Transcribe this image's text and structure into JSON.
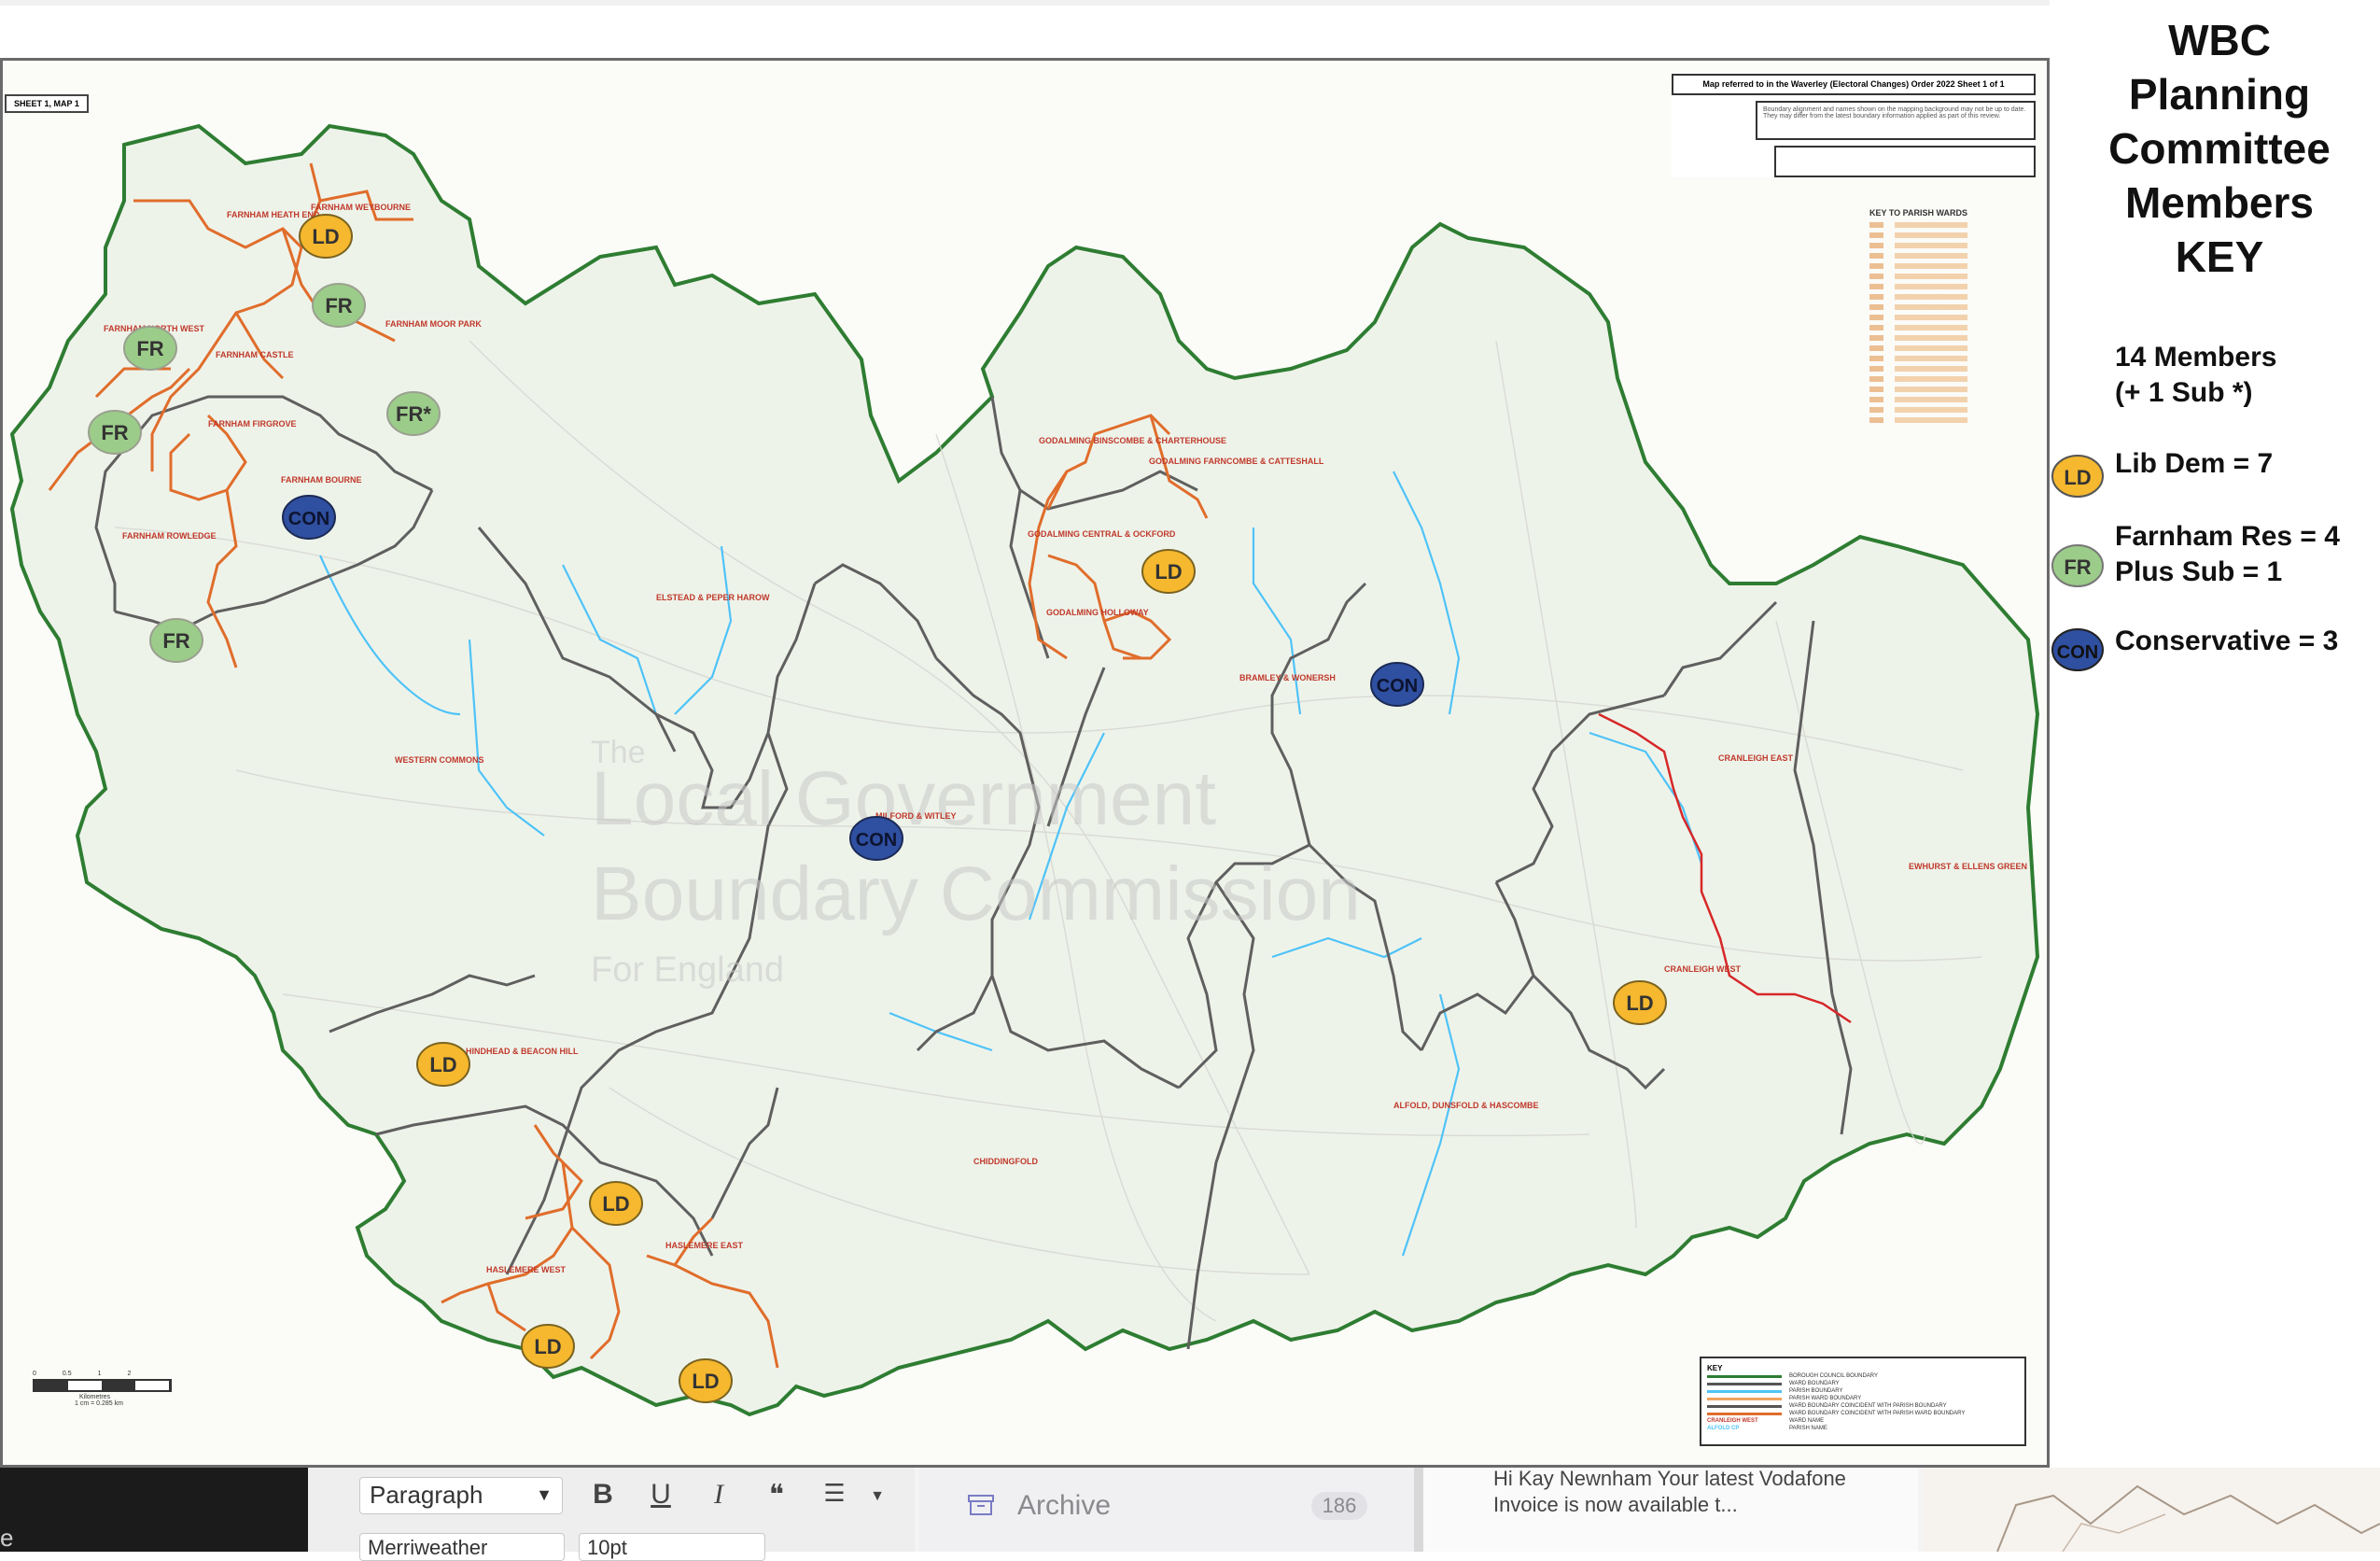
{
  "map": {
    "sheet_label": "SHEET 1, MAP 1",
    "order_title": "Map referred to in the Waverley (Electoral Changes) Order 2022 Sheet 1 of 1",
    "order_note": "Boundary alignment and names shown on the mapping background may not be up to date. They may differ from the latest boundary information applied as part of this review.",
    "parish_key_title": "KEY TO PARISH WARDS",
    "watermark": [
      "The",
      "Local Government",
      "Boundary Commission",
      "For England"
    ],
    "wards": [
      "FARNHAM HEATH END",
      "FARNHAM WEYBOURNE",
      "FARNHAM NORTH WEST",
      "FARNHAM CASTLE",
      "FARNHAM MOOR PARK",
      "FARNHAM FIRGROVE",
      "FARNHAM BOURNE",
      "FARNHAM ROWLEDGE",
      "GODALMING BINSCOMBE & CHARTERHOUSE",
      "GODALMING FARNCOMBE & CATTESHALL",
      "GODALMING CENTRAL & OCKFORD",
      "GODALMING HOLLOWAY",
      "ELSTEAD & PEPER HAROW",
      "BRAMLEY & WONERSH",
      "WESTERN COMMONS",
      "MILFORD & WITLEY",
      "CRANLEIGH EAST",
      "CRANLEIGH WEST",
      "EWHURST & ELLENS GREEN",
      "HINDHEAD & BEACON HILL",
      "HASLEMERE WEST",
      "HASLEMERE EAST",
      "CHIDDINGFOLD",
      "ALFOLD, DUNSFOLD & HASCOMBE"
    ],
    "map_key": {
      "title": "KEY",
      "rows": [
        {
          "label": "BOROUGH COUNCIL BOUNDARY",
          "color": "#2e7d32"
        },
        {
          "label": "WARD BOUNDARY",
          "color": "#555555"
        },
        {
          "label": "PARISH BOUNDARY",
          "color": "#4fc3f7"
        },
        {
          "label": "PARISH WARD BOUNDARY",
          "color": "#f0a35e"
        },
        {
          "label": "WARD BOUNDARY COINCIDENT WITH PARISH BOUNDARY",
          "color": "#555555"
        },
        {
          "label": "WARD BOUNDARY COINCIDENT WITH PARISH WARD BOUNDARY",
          "color": "#e06d2b"
        },
        {
          "label": "WARD NAME",
          "color": "#c0392b",
          "sample": "CRANLEIGH WEST"
        },
        {
          "label": "PARISH NAME",
          "color": "#4fc3f7",
          "sample": "ALFOLD CP"
        }
      ]
    },
    "scale": {
      "ticks": [
        "0",
        "0.5",
        "1",
        "2"
      ],
      "unit": "Kilometres",
      "ratio": "1 cm = 0.285 km"
    },
    "markers": [
      {
        "type": "LD",
        "label": "LD"
      },
      {
        "type": "FR",
        "label": "FR"
      },
      {
        "type": "FR",
        "label": "FR"
      },
      {
        "type": "FR",
        "label": "FR"
      },
      {
        "type": "FR",
        "label": "FR*"
      },
      {
        "type": "CON",
        "label": "CON"
      },
      {
        "type": "FR",
        "label": "FR"
      },
      {
        "type": "LD",
        "label": "LD"
      },
      {
        "type": "CON",
        "label": "CON"
      },
      {
        "type": "CON",
        "label": "CON"
      },
      {
        "type": "LD",
        "label": "LD"
      },
      {
        "type": "LD",
        "label": "LD"
      },
      {
        "type": "LD",
        "label": "LD"
      },
      {
        "type": "LD",
        "label": "LD"
      },
      {
        "type": "LD",
        "label": "LD"
      }
    ]
  },
  "key_panel": {
    "title_lines": [
      "WBC",
      "Planning",
      "Committee",
      "Members",
      "KEY"
    ],
    "members_line1": "14 Members",
    "members_line2": "(+ 1 Sub *)",
    "legend": [
      {
        "badge": "LD",
        "line1": "Lib Dem = 7",
        "line2": "",
        "color": "#f5b82e"
      },
      {
        "badge": "FR",
        "line1": "Farnham Res = 4",
        "line2": "Plus Sub = 1",
        "color": "#9ccc8a"
      },
      {
        "badge": "CON",
        "line1": "Conservative = 3",
        "line2": "",
        "color": "#2f4fa0"
      }
    ]
  },
  "taskbar": {
    "left_fragment": "e",
    "paragraph_select": "Paragraph",
    "bold": "B",
    "underline": "U",
    "italic": "I",
    "quote": "❝",
    "list": "☰",
    "font_select": "Merriweather",
    "size_select": "10pt",
    "archive_label": "Archive",
    "archive_count": "186",
    "email_preview": "Hi Kay Newnham Your latest Vodafone Invoice is now available t..."
  }
}
